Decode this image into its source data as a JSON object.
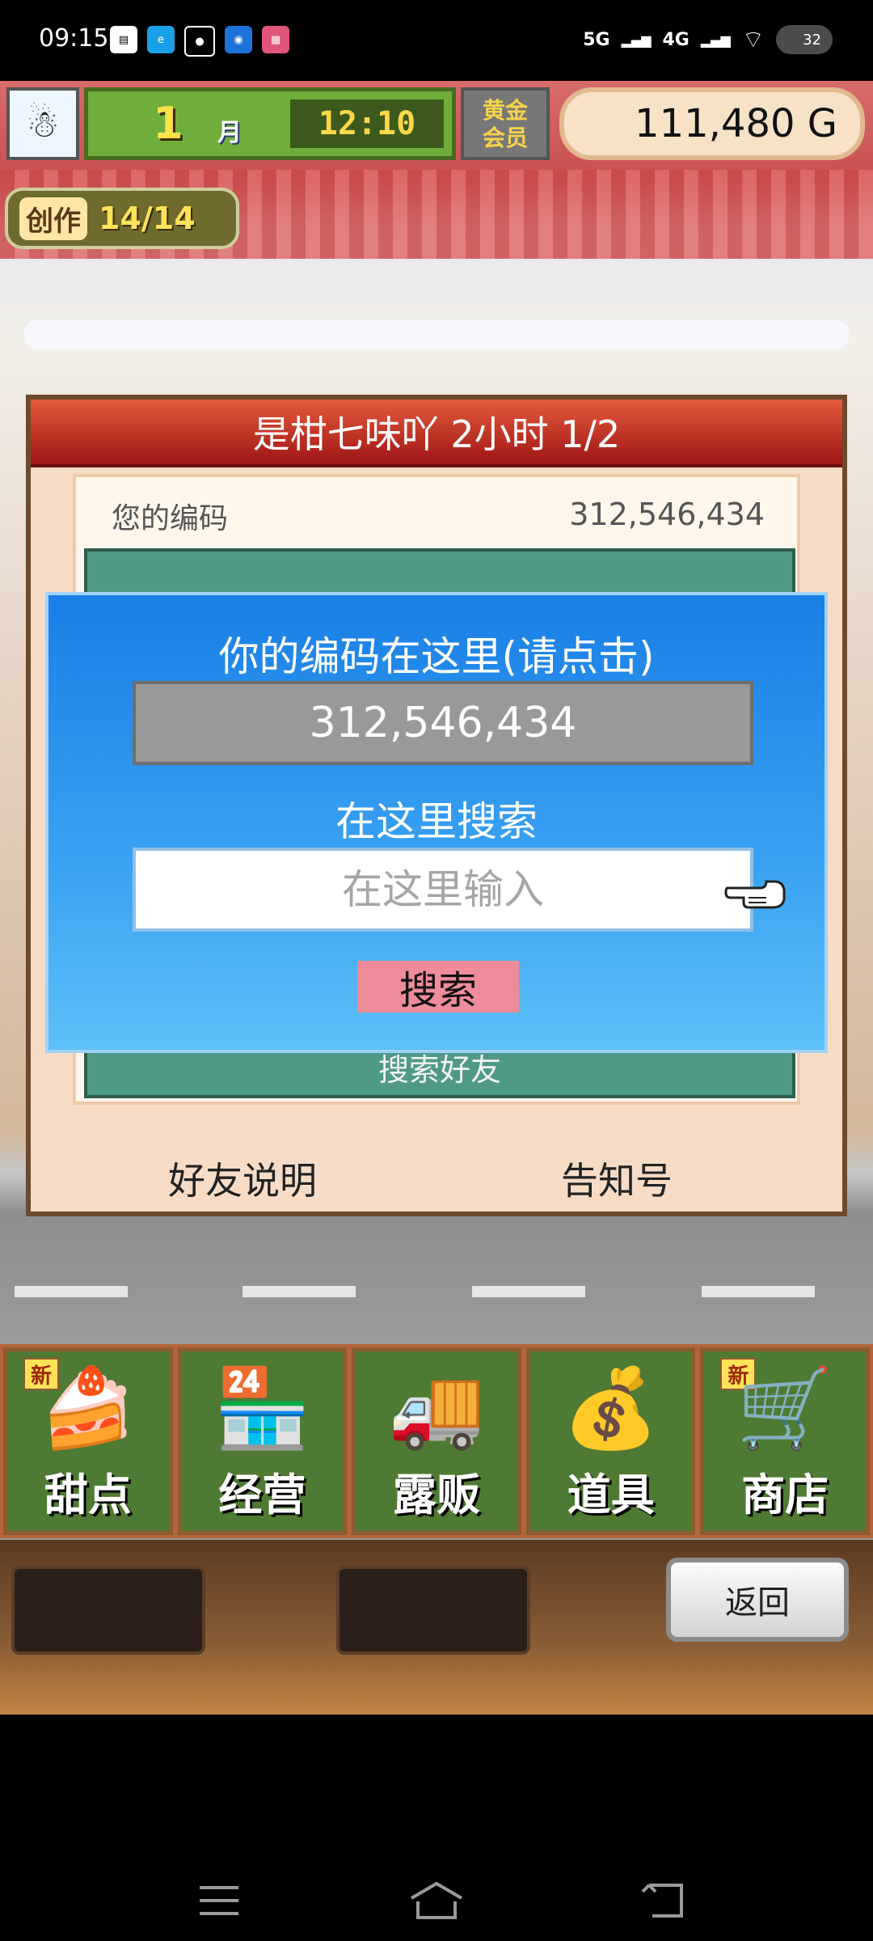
{
  "status_bar": {
    "time": "09:15",
    "icons": [
      "book-icon",
      "e-icon",
      "du-icon",
      "chat-icon",
      "app-icon"
    ],
    "net_5g": "5G",
    "net_4g": "4G",
    "battery": "32"
  },
  "hud": {
    "month_num": "1",
    "month_label": "月",
    "clock": "12:10",
    "gold_icon_text": "黄金\n会员",
    "money": "111,480 G"
  },
  "create_badge": {
    "label": "创作",
    "count": "14/14"
  },
  "panel": {
    "title": "是柑七味吖  2小时 1/2",
    "code_label": "您的编码",
    "code_value": "312,546,434",
    "green_top_text": "搜索好友",
    "green_bottom_text": "搜索好友",
    "link_left": "好友说明",
    "link_right": "告知号"
  },
  "dialog": {
    "title": "你的编码在这里(请点击)",
    "code": "312,546,434",
    "search_label": "在这里搜索",
    "input_placeholder": "在这里输入",
    "input_value": "",
    "search_button": "搜索"
  },
  "menu": [
    {
      "label": "甜点",
      "icon": "cake-icon",
      "glyph": "🍰",
      "new": true
    },
    {
      "label": "经营",
      "icon": "shop-building-icon",
      "glyph": "🏪",
      "new": false
    },
    {
      "label": "露贩",
      "icon": "food-truck-icon",
      "glyph": "🚚",
      "new": false
    },
    {
      "label": "道具",
      "icon": "item-bag-icon",
      "glyph": "💰",
      "new": false
    },
    {
      "label": "商店",
      "icon": "cart-icon",
      "glyph": "🛒",
      "new": true
    }
  ],
  "new_badge_text": "新",
  "back_button": "返回",
  "colors": {
    "dialog_blue": "#1a7fe6",
    "panel_title_red": "#b01c1c",
    "menu_green": "#4f7a33",
    "search_button_pink": "#ef8c9a"
  }
}
